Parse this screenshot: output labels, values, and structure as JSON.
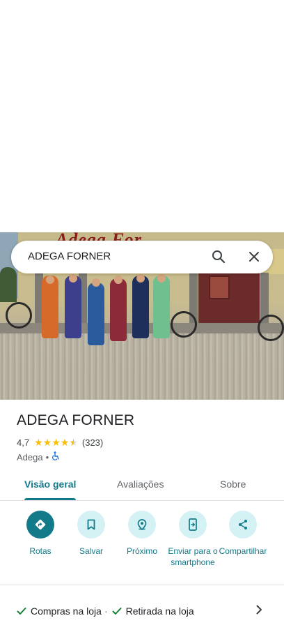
{
  "search": {
    "query": "ADEGA FORNER"
  },
  "photo": {
    "sign_text": "Adega For"
  },
  "place": {
    "name": "ADEGA FORNER",
    "rating": "4,7",
    "rating_value": 4.7,
    "review_count": "(323)",
    "category": "Adega",
    "separator": "•"
  },
  "tabs": [
    {
      "label": "Visão geral"
    },
    {
      "label": "Avaliações"
    },
    {
      "label": "Sobre"
    }
  ],
  "actions": [
    {
      "label": "Rotas",
      "icon": "directions-icon"
    },
    {
      "label": "Salvar",
      "icon": "bookmark-icon"
    },
    {
      "label": "Próximo",
      "icon": "nearby-icon"
    },
    {
      "label": "Enviar para o smartphone",
      "icon": "send-to-phone-icon"
    },
    {
      "label": "Compartilhar",
      "icon": "share-icon"
    }
  ],
  "services": {
    "item1": "Compras na loja",
    "sep": "·",
    "item2": "Retirada na loja"
  },
  "colors": {
    "accent": "#137a8a",
    "accent_light": "#d4f1f4",
    "star": "#fbbc04"
  }
}
